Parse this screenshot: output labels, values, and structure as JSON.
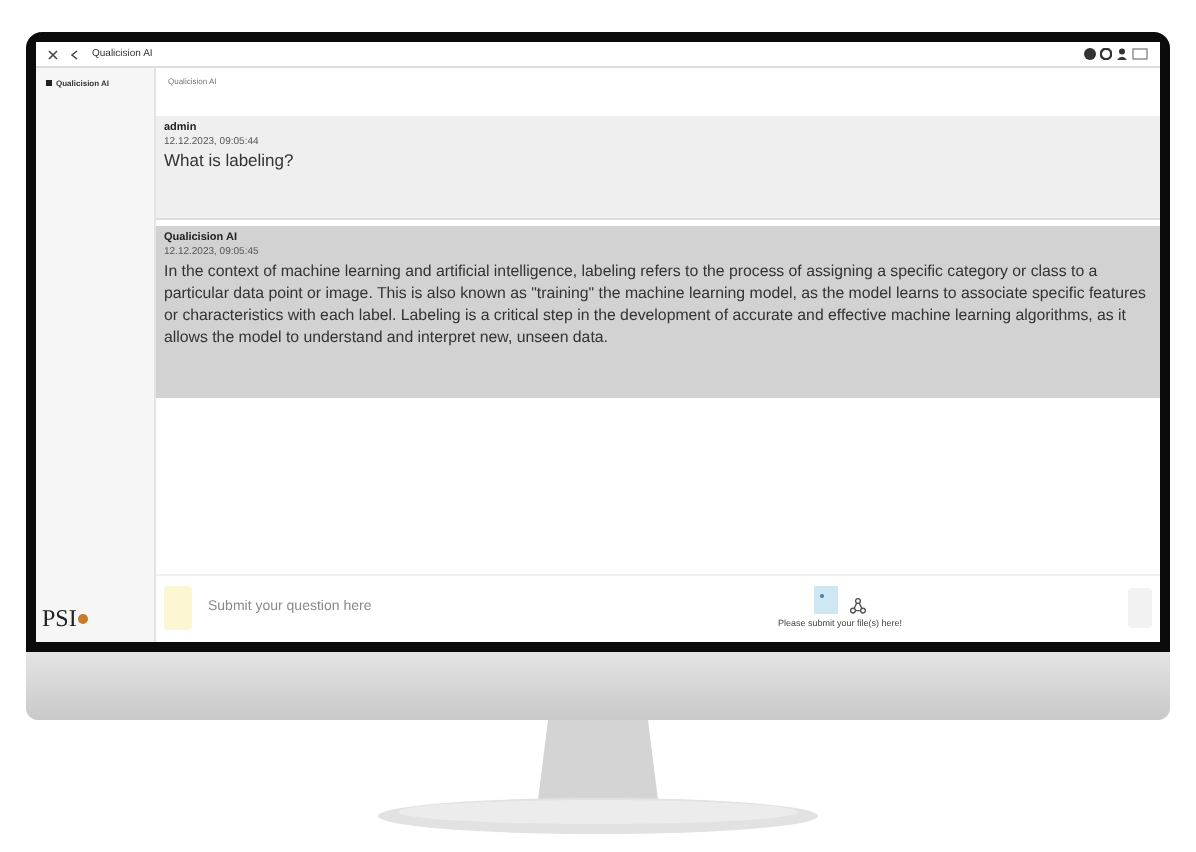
{
  "window": {
    "title": "Qualicision AI"
  },
  "sidebar": {
    "items": [
      {
        "label": "Qualicision AI",
        "selected": true
      }
    ],
    "logo": "PSI"
  },
  "breadcrumb": "Qualicision AI",
  "messages": [
    {
      "author": "admin",
      "time": "12.12.2023, 09:05:44",
      "text": "What is labeling?",
      "kind": "user"
    },
    {
      "author": "Qualicision AI",
      "time": "12.12.2023, 09:05:45",
      "text": "In the context of machine learning and artificial intelligence, labeling refers to the process of assigning a specific category or class to a particular data point or image. This is also known as \"training\" the machine learning model, as the model learns to associate specific features or characteristics with each label. Labeling is a critical step in the development of accurate and effective machine learning algorithms, as it allows the model to understand and interpret new, unseen data.",
      "kind": "bot"
    }
  ],
  "composer": {
    "placeholder": "Submit your question here",
    "upload_hint": "Please submit your file(s) here!"
  }
}
